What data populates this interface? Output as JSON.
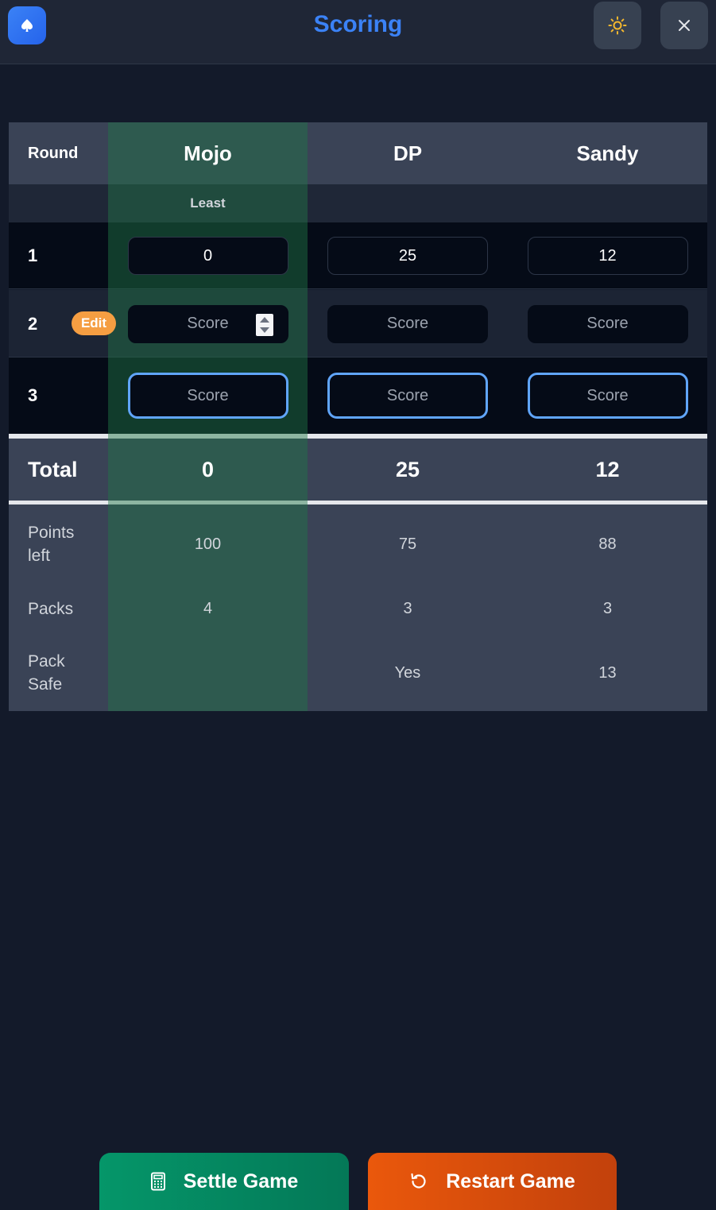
{
  "header": {
    "title": "Scoring",
    "logo_icon": "spade-icon",
    "theme_icon": "sun-icon",
    "close_icon": "close-icon"
  },
  "table": {
    "round_header": "Round",
    "players": [
      "Mojo",
      "DP",
      "Sandy"
    ],
    "sub_labels": [
      "Least",
      "",
      ""
    ],
    "rounds": [
      {
        "number": "1",
        "scores": [
          "0",
          "25",
          "12"
        ]
      },
      {
        "number": "2",
        "scores": [
          "",
          "",
          ""
        ],
        "placeholder": "Score",
        "edit_label": "Edit"
      },
      {
        "number": "3",
        "scores": [
          "",
          "",
          ""
        ],
        "placeholder": "Score"
      }
    ],
    "total_label": "Total",
    "totals": [
      "0",
      "25",
      "12"
    ],
    "stats": [
      {
        "label": "Points left",
        "values": [
          "100",
          "75",
          "88"
        ]
      },
      {
        "label": "Packs",
        "values": [
          "4",
          "3",
          "3"
        ]
      },
      {
        "label": "Pack Safe",
        "values": [
          "",
          "Yes",
          "13"
        ]
      }
    ]
  },
  "actions": {
    "settle_label": "Settle Game",
    "settle_icon": "calculator-icon",
    "restart_label": "Restart Game",
    "restart_icon": "rotate-icon"
  },
  "colors": {
    "accent": "#3b82f6",
    "highlight_column": "#22784a",
    "edit_badge": "#f59e42",
    "settle": "#059669",
    "restart": "#ea580c"
  }
}
